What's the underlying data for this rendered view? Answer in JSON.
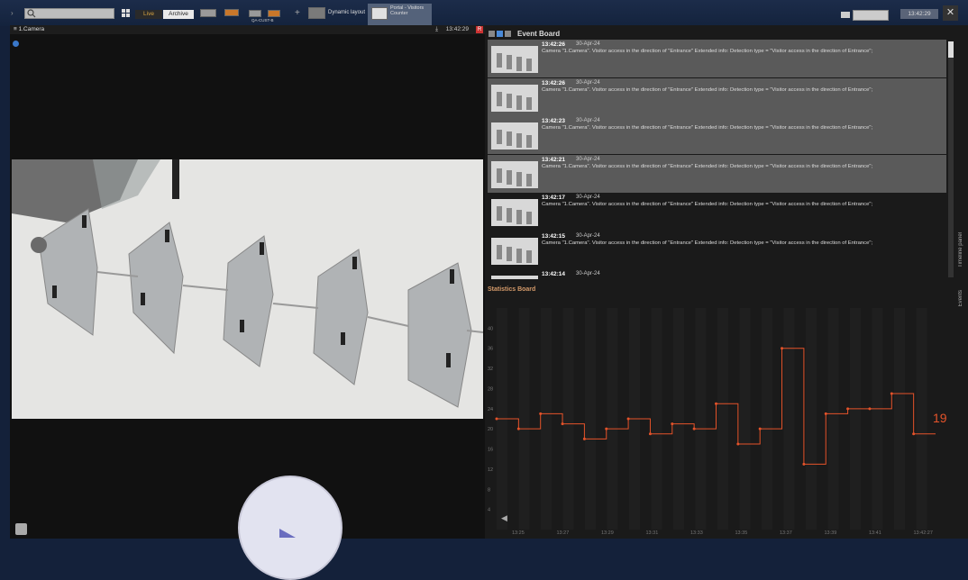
{
  "toolbar": {
    "search_placeholder": "",
    "live_label": "Live",
    "archive_label": "Archive",
    "layout_small_label": "QA-CUST-B",
    "dynamic_layout_label": "Dynamic layout",
    "portal_label": "Portal - Visitors Counter",
    "clock": "13:42:29",
    "add_label": "+"
  },
  "camera": {
    "title": "1.Camera",
    "time": "13:42:29",
    "rec": "R"
  },
  "event_board": {
    "title": "Event Board",
    "events": [
      {
        "time": "13:42:26",
        "date": "30-Apr-24",
        "text": "Camera \"1.Camera\". Visitor access in the direction of \"Entrance\" Extended info: Detection type = \"Visitor access in the direction of Entrance\";",
        "selected": true
      },
      {
        "time": "13:42:26",
        "date": "30-Apr-24",
        "text": "Camera \"1.Camera\". Visitor access in the direction of \"Entrance\" Extended info: Detection type = \"Visitor access in the direction of Entrance\";",
        "selected": true
      },
      {
        "time": "13:42:23",
        "date": "30-Apr-24",
        "text": "Camera \"1.Camera\". Visitor access in the direction of \"Entrance\" Extended info: Detection type = \"Visitor access in the direction of Entrance\";",
        "selected": true
      },
      {
        "time": "13:42:21",
        "date": "30-Apr-24",
        "text": "Camera \"1.Camera\". Visitor access in the direction of \"Entrance\" Extended info: Detection type = \"Visitor access in the direction of Entrance\";",
        "selected": true
      },
      {
        "time": "13:42:17",
        "date": "30-Apr-24",
        "text": "Camera \"1.Camera\". Visitor access in the direction of \"Entrance\" Extended info: Detection type = \"Visitor access in the direction of Entrance\";",
        "selected": false
      },
      {
        "time": "13:42:15",
        "date": "30-Apr-24",
        "text": "Camera \"1.Camera\". Visitor access in the direction of \"Entrance\" Extended info: Detection type = \"Visitor access in the direction of Entrance\";",
        "selected": false
      },
      {
        "time": "13:42:14",
        "date": "30-Apr-24",
        "text": "",
        "selected": false
      }
    ]
  },
  "statistics_board": {
    "title": "Statistics Board",
    "current_value": "19"
  },
  "side_tabs": {
    "timeline": "Timeline panel",
    "events": "Events"
  },
  "colors": {
    "accent_orange": "#e5532a",
    "selected_row": "#5a5a5a",
    "live_text": "#d9a541"
  },
  "chart_data": {
    "type": "line",
    "step": true,
    "x": [
      "13:25",
      "13:27",
      "13:29",
      "13:31",
      "13:33",
      "13:35",
      "13:37",
      "13:39",
      "13:41",
      "13:42:27"
    ],
    "xticks": [
      "13:25",
      "13:27",
      "13:29",
      "13:31",
      "13:33",
      "13:35",
      "13:37",
      "13:39",
      "13:41",
      "13:42:27"
    ],
    "series": [
      {
        "values": [
          22,
          20,
          23,
          21,
          18,
          20,
          22,
          19,
          21,
          20,
          25,
          17,
          20,
          36,
          13,
          23,
          24,
          24,
          27,
          19
        ]
      }
    ],
    "ylim": [
      0,
      44
    ],
    "yticks": [
      4,
      8,
      12,
      16,
      20,
      24,
      28,
      32,
      36,
      40
    ],
    "grid": false,
    "title": "",
    "xlabel": "",
    "ylabel": ""
  }
}
